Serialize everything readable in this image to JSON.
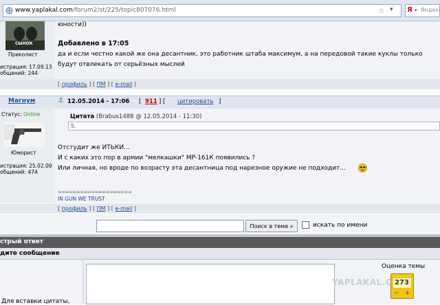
{
  "browser": {
    "url_host": "www.yaplakal.com",
    "url_path": "/forum2/st/225/topic807076.html",
    "search_placeholder": "Яндекс"
  },
  "post1": {
    "avatar_caption": "СЫНОК",
    "user_title": "Приколист",
    "registration": "истрация: 17.09.13",
    "messages": "общений: 244",
    "quote_tail": "юности))",
    "added_label": "Добавлено в 17:05",
    "text_line1": "да и если честно какой же она десантник, это работник штаба максимум, а на передовой такие куклы только",
    "text_line2": "будут отвлекать от серьёзных мыслей",
    "links": {
      "profile": "профиль",
      "pm": "ПМ",
      "email": "e-mail"
    }
  },
  "post2": {
    "username": "Магнум",
    "date": "12.05.2014 - 17:06",
    "post_number": "911",
    "quote_label": "цитировать",
    "status_label": "Статус:",
    "status_value": "Online",
    "user_title": "Юморист",
    "registration": "истрация: 25.02.09",
    "messages": "общений: 474",
    "quote": {
      "title": "Цитата",
      "meta": "(Brabus1488 @ 12.05.2014 - 11:30)",
      "body": "5."
    },
    "lines": [
      "Отстудит же ИТЬКИ...",
      "И с каких это пор в армии \"мелкашки\" МР-161К появились ?",
      "Или личная, но вроде по возрасту эта десантница под нарезное оружие не подходит..."
    ],
    "signature_rule": "====================",
    "signature": "IN GUN WE TRUST",
    "links": {
      "profile": "профиль",
      "pm": "ПМ",
      "email": "e-mail"
    }
  },
  "search": {
    "button_label": "Поиск в теме »",
    "checkbox_label": "искать по имени"
  },
  "quick_reply": {
    "title": "стрый ответ",
    "subtitle": "дите сообщение",
    "hint": "Для вставки цитаты,",
    "rating_label": "Оценка темы",
    "rating_value": "273",
    "watermark": "YAPLAKAL.COM"
  },
  "colors": {
    "online": "#2a9a2a",
    "post_number": "#c00000",
    "link": "#1f4c8f",
    "bar_dark": "#5a5a5a"
  }
}
